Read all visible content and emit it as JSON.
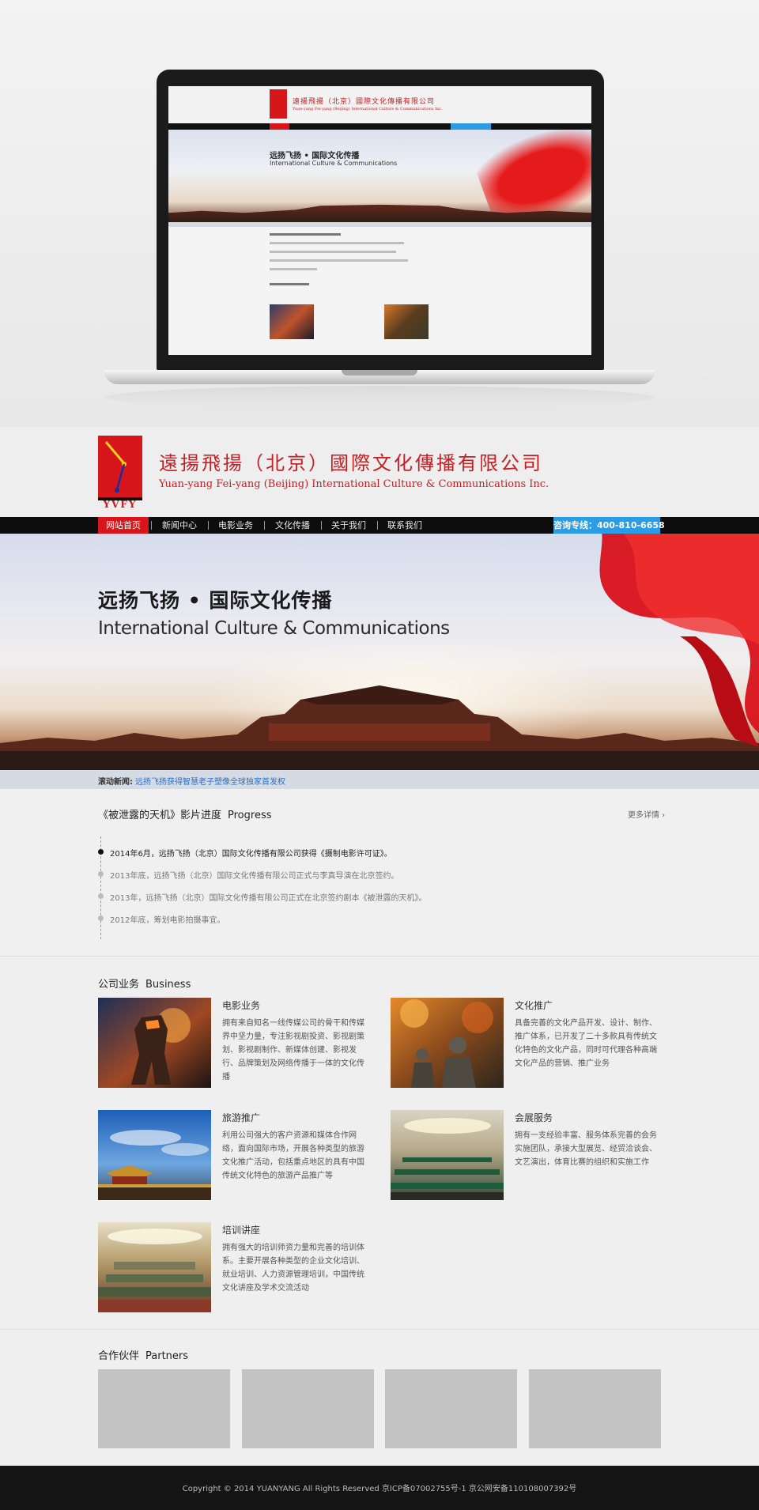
{
  "company": {
    "title": "遠揚飛揚（北京）國際文化傳播有限公司",
    "subtitle": "Yuan-yang Fei-yang (Beijing) International Culture & Communications Inc.",
    "logo_letters": "YVFY",
    "brand_red": "#d6161b"
  },
  "nav": {
    "items": [
      {
        "label": "网站首页",
        "active": true
      },
      {
        "label": "新闻中心"
      },
      {
        "label": "电影业务"
      },
      {
        "label": "文化传播"
      },
      {
        "label": "关于我们"
      },
      {
        "label": "联系我们"
      }
    ],
    "hotline": "咨询专线：400-810-6658",
    "hotline_color": "#2b9ce6"
  },
  "banner": {
    "title": "远扬飞扬 • 国际文化传播",
    "subtitle": "International Culture & Communications"
  },
  "ticker": {
    "label": "滚动新闻:",
    "text": "远扬飞扬获得智慧老子塑像全球独家首发权"
  },
  "progress": {
    "title": "《被泄露的天机》影片进度",
    "title_en": "Progress",
    "more": "更多详情 ›",
    "items": [
      "2014年6月，远扬飞扬（北京）国际文化传播有限公司获得《摄制电影许可证》。",
      "2013年底，远扬飞扬（北京）国际文化传播有限公司正式与李真导演在北京签约。",
      "2013年，远扬飞扬（北京）国际文化传播有限公司正式在北京签约剧本《被泄露的天机》。",
      "2012年底，筹划电影拍摄事宜。"
    ]
  },
  "business": {
    "title": "公司业务",
    "title_en": "Business",
    "items": [
      {
        "title": "电影业务",
        "icon": "movie-thumb",
        "desc": "拥有来自知名一线传媒公司的骨干和传媒界中坚力量，专注影视剧投资、影视剧策划、影视剧制作、新媒体创建、影视发行、品牌策划及网络传播于一体的文化传播"
      },
      {
        "title": "文化推广",
        "icon": "culture-thumb",
        "desc": "具备完善的文化产品开发、设计、制作、推广体系，已开发了二十多款具有传统文化特色的文化产品，同时可代理各种高端文化产品的营销、推广业务"
      },
      {
        "title": "旅游推广",
        "icon": "tourism-thumb",
        "desc": "利用公司强大的客户资源和媒体合作网络，面向国际市场，开展各种类型的旅游文化推广活动，包括重点地区的具有中国传统文化特色的旅游产品推广等"
      },
      {
        "title": "会展服务",
        "icon": "convention-thumb",
        "desc": "拥有一支经验丰富、服务体系完善的会务实施团队，承接大型展览、经贸洽谈会、文艺演出，体育比赛的组织和实施工作"
      },
      {
        "title": "培训讲座",
        "icon": "training-thumb",
        "desc": "拥有强大的培训师资力量和完善的培训体系。主要开展各种类型的企业文化培训、就业培训、人力资源管理培训，中国传统文化讲座及学术交流活动"
      }
    ]
  },
  "partners": {
    "title": "合作伙伴",
    "title_en": "Partners"
  },
  "footer": {
    "text": "Copyright © 2014  YUANYANG All Rights Reserved  京ICP备07002755号-1  京公网安备110108007392号"
  }
}
